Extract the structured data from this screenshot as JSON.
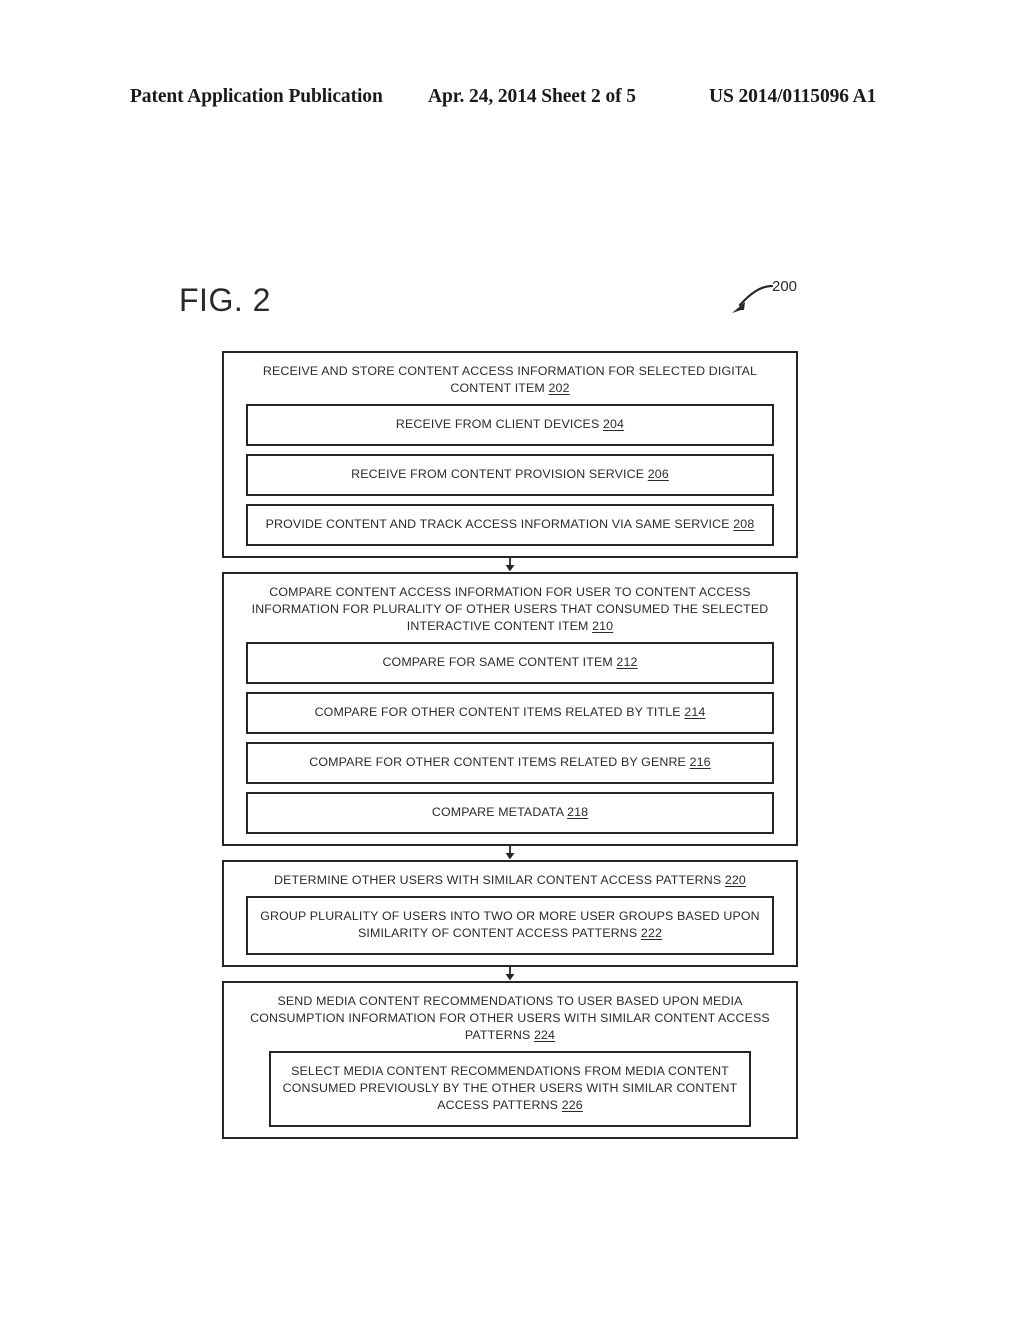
{
  "header": {
    "left": "Patent Application Publication",
    "middle": "Apr. 24, 2014  Sheet 2 of 5",
    "right": "US 2014/0115096 A1"
  },
  "figure": {
    "label": "FIG. 2",
    "reference_numeral": "200",
    "lead_arrow_icon": "curved-arrow-icon"
  },
  "flowchart": {
    "arrow_icon": "down-arrow-icon",
    "blocks": [
      {
        "title": "RECEIVE AND STORE CONTENT ACCESS INFORMATION FOR SELECTED DIGITAL CONTENT ITEM ",
        "title_ref": "202",
        "substeps": [
          {
            "text": "RECEIVE FROM CLIENT DEVICES ",
            "ref": "204"
          },
          {
            "text": "RECEIVE FROM CONTENT PROVISION SERVICE ",
            "ref": "206"
          },
          {
            "text": "PROVIDE CONTENT AND TRACK ACCESS INFORMATION VIA SAME SERVICE ",
            "ref": "208"
          }
        ]
      },
      {
        "title": "COMPARE CONTENT ACCESS INFORMATION FOR USER TO CONTENT ACCESS INFORMATION FOR PLURALITY OF OTHER USERS THAT CONSUMED THE SELECTED INTERACTIVE CONTENT ITEM ",
        "title_ref": "210",
        "substeps": [
          {
            "text": "COMPARE FOR SAME CONTENT ITEM ",
            "ref": "212"
          },
          {
            "text": "COMPARE FOR OTHER CONTENT ITEMS RELATED BY TITLE ",
            "ref": "214"
          },
          {
            "text": "COMPARE FOR OTHER CONTENT ITEMS RELATED BY GENRE ",
            "ref": "216"
          },
          {
            "text": "COMPARE METADATA  ",
            "ref": "218"
          }
        ]
      },
      {
        "title": "DETERMINE OTHER USERS WITH SIMILAR CONTENT ACCESS PATTERNS ",
        "title_ref": "220",
        "substeps": [
          {
            "text": "GROUP PLURALITY OF USERS INTO TWO OR MORE USER GROUPS BASED UPON SIMILARITY OF CONTENT ACCESS PATTERNS ",
            "ref": "222"
          }
        ]
      },
      {
        "title": "SEND MEDIA CONTENT RECOMMENDATIONS TO USER BASED UPON MEDIA CONSUMPTION INFORMATION FOR OTHER USERS WITH SIMILAR CONTENT ACCESS PATTERNS ",
        "title_ref": "224",
        "substeps": [
          {
            "text": "SELECT MEDIA CONTENT RECOMMENDATIONS FROM MEDIA CONTENT CONSUMED PREVIOUSLY BY THE OTHER USERS WITH SIMILAR CONTENT ACCESS PATTERNS  ",
            "ref": "226",
            "wide_inset": true
          }
        ]
      }
    ]
  },
  "colors": {
    "line": "#262626",
    "text": "#2b2b2b",
    "background": "#ffffff"
  }
}
